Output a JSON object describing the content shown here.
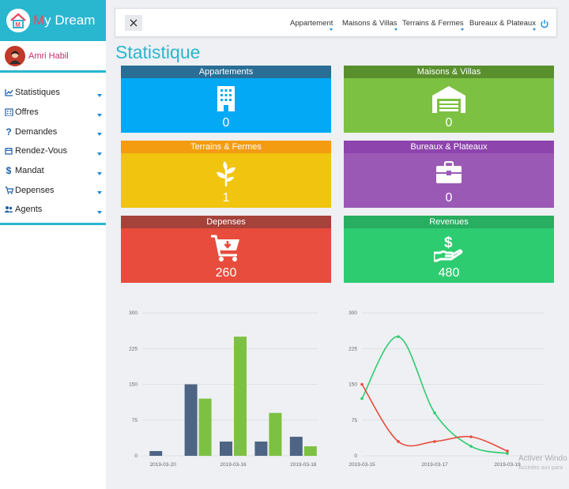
{
  "app": {
    "brand_prefix": "M",
    "brand_rest": "y Dream"
  },
  "user": {
    "name": "Amri Habil"
  },
  "sidebar": {
    "items": [
      {
        "label": "Statistiques",
        "icon": "chart-line-icon"
      },
      {
        "label": "Offres",
        "icon": "building-icon"
      },
      {
        "label": "Demandes",
        "icon": "question-icon"
      },
      {
        "label": "Rendez-Vous",
        "icon": "calendar-icon"
      },
      {
        "label": "Mandat",
        "icon": "dollar-icon"
      },
      {
        "label": "Depenses",
        "icon": "cart-icon"
      },
      {
        "label": "Agents",
        "icon": "users-icon"
      }
    ]
  },
  "topbar": {
    "nav": [
      "Appartement",
      "Maisons & Villas",
      "Terrains & Fermes",
      "Bureaux & Plateaux"
    ]
  },
  "page": {
    "title": "Statistique"
  },
  "cards": [
    {
      "title": "Appartements",
      "value": "0",
      "icon": "building-icon",
      "header_color": "#2a6e96",
      "body_color": "#03a9f4"
    },
    {
      "title": "Maisons & Villas",
      "value": "0",
      "icon": "warehouse-icon",
      "header_color": "#5a8f2e",
      "body_color": "#7dc142"
    },
    {
      "title": "Terrains & Fermes",
      "value": "1",
      "icon": "seedling-icon",
      "header_color": "#f39c12",
      "body_color": "#f1c40f"
    },
    {
      "title": "Bureaux & Plateaux",
      "value": "0",
      "icon": "toolbox-icon",
      "header_color": "#8e44ad",
      "body_color": "#9b59b6"
    },
    {
      "title": "Depenses",
      "value": "260",
      "icon": "cart-down-icon",
      "header_color": "#a5423a",
      "body_color": "#e74c3c"
    },
    {
      "title": "Revenues",
      "value": "480",
      "icon": "hand-dollar-icon",
      "header_color": "#27ae60",
      "body_color": "#2ecc71"
    }
  ],
  "chart_data": [
    {
      "type": "bar",
      "categories": [
        "2019-03-20",
        "",
        "2019-03-16",
        "",
        "2019-03-18"
      ],
      "yticks": [
        "0",
        "75",
        "150",
        "225",
        "300"
      ],
      "ylim": [
        0,
        300
      ],
      "series": [
        {
          "values": [
            10,
            150,
            30,
            30,
            40
          ],
          "color": "#4e6484"
        },
        {
          "values": [
            0,
            120,
            250,
            90,
            20
          ],
          "color": "#7dc142"
        }
      ],
      "grid": true
    },
    {
      "type": "line",
      "categories": [
        "2019-03-15",
        "",
        "2019-03-17",
        "",
        "2019-03-19",
        ""
      ],
      "yticks": [
        "0",
        "75",
        "150",
        "225",
        "300"
      ],
      "ylim": [
        0,
        300
      ],
      "series": [
        {
          "values": [
            120,
            250,
            90,
            20,
            5
          ],
          "color": "#2ecc71"
        },
        {
          "values": [
            150,
            30,
            30,
            40,
            10
          ],
          "color": "#e74c3c"
        }
      ],
      "grid": true
    }
  ],
  "watermark": {
    "line1": "Activer Windo",
    "line2": "Accédez aux para"
  }
}
